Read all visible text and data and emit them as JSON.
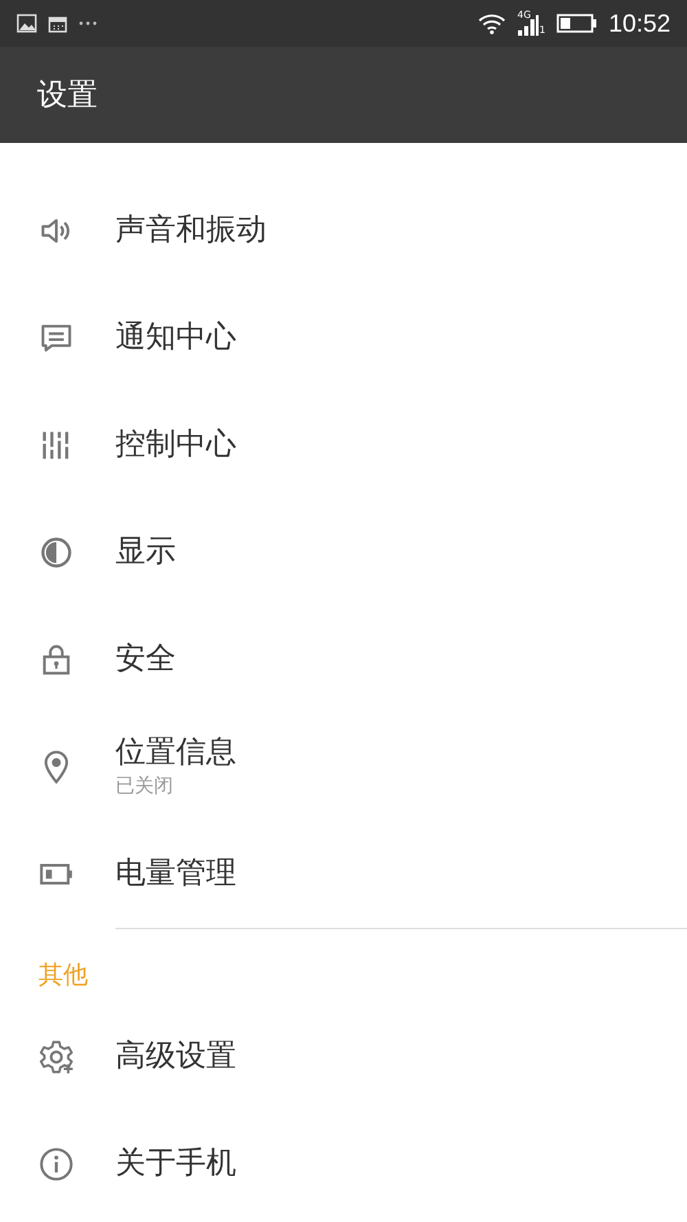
{
  "status_bar": {
    "network": "4G",
    "sim": "1",
    "time": "10:52"
  },
  "app_bar": {
    "title": "设置"
  },
  "sections": [
    {
      "items": [
        {
          "label": "声音和振动"
        },
        {
          "label": "通知中心"
        },
        {
          "label": "控制中心"
        },
        {
          "label": "显示"
        },
        {
          "label": "安全"
        },
        {
          "label": "位置信息",
          "subtitle": "已关闭"
        },
        {
          "label": "电量管理"
        }
      ]
    },
    {
      "header": "其他",
      "items": [
        {
          "label": "高级设置"
        },
        {
          "label": "关于手机"
        }
      ]
    }
  ]
}
